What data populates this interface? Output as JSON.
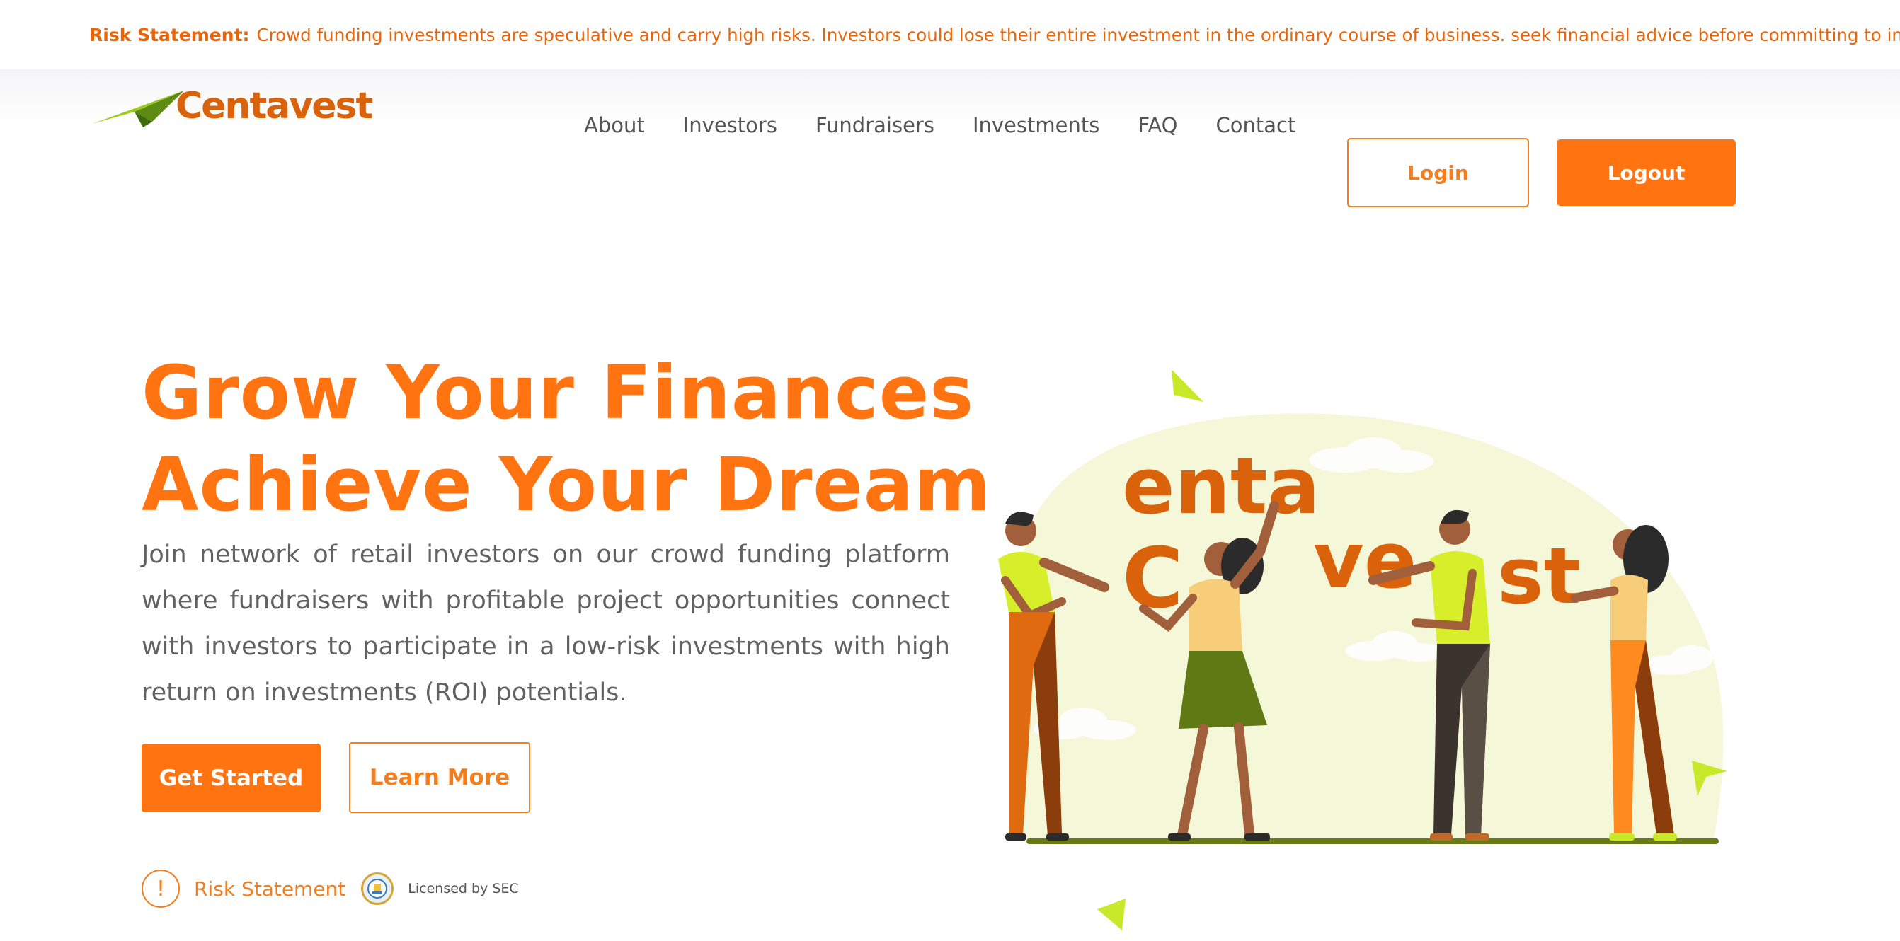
{
  "risk_banner": {
    "label": "Risk Statement:",
    "text": "Crowd funding investments are speculative and carry high risks. Investors could lose their entire investment in the ordinary course of business. seek financial advice before committing to investment."
  },
  "brand": {
    "name": "Centavest"
  },
  "nav": {
    "items": [
      "About",
      "Investors",
      "Fundraisers",
      "Investments",
      "FAQ",
      "Contact"
    ],
    "login": "Login",
    "logout": "Logout"
  },
  "hero": {
    "title_line1": "Grow Your Finances",
    "title_line2": "Achieve Your Dream",
    "description": "Join network of retail investors on our crowd funding platform where fundraisers with profitable project opportunities connect with investors to participate in a low-risk investments with high return on investments (ROI) potentials.",
    "primary_cta": "Get Started",
    "secondary_cta": "Learn More",
    "risk_link": "Risk Statement",
    "risk_icon_glyph": "!",
    "license": "Licensed by SEC"
  },
  "illustration": {
    "letters": [
      "C",
      "enta",
      "ve",
      "st"
    ]
  },
  "colors": {
    "accent": "#ff7410",
    "brand_dark": "#d9620a",
    "lime": "#c8e92a",
    "pale": "#f4f8d8"
  }
}
